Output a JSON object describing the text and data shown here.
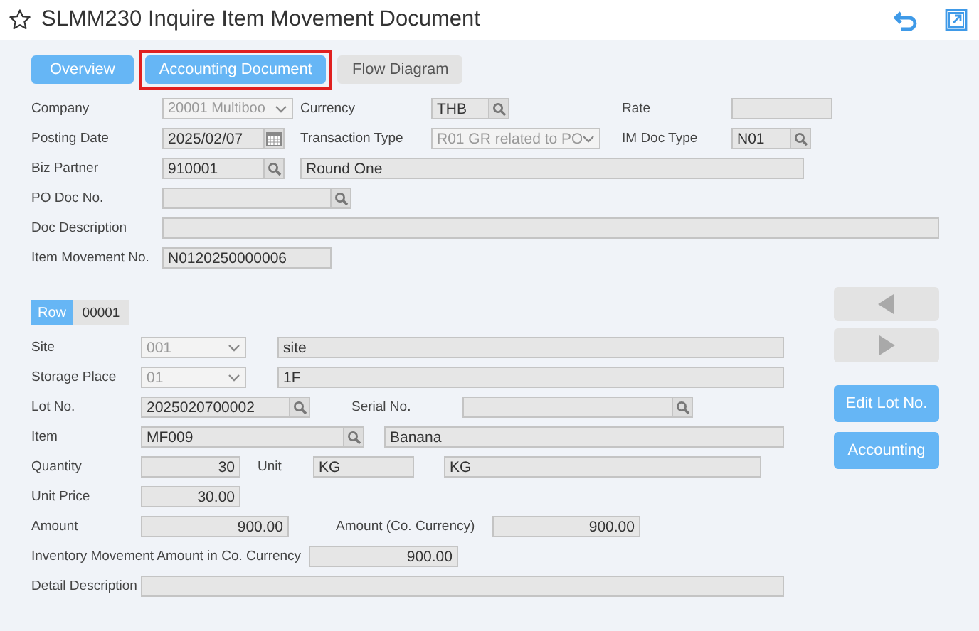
{
  "header": {
    "title": "SLMM230 Inquire Item Movement Document"
  },
  "tabs": [
    {
      "label": "Overview",
      "active": true,
      "highlighted": false
    },
    {
      "label": "Accounting Document",
      "active": true,
      "highlighted": true
    },
    {
      "label": "Flow Diagram",
      "active": false,
      "highlighted": false
    }
  ],
  "document": {
    "company": {
      "label": "Company",
      "kind": "select",
      "value": "20001 Multiboo",
      "disabled": true
    },
    "currency": {
      "label": "Currency",
      "kind": "lookup",
      "value": "THB"
    },
    "rate": {
      "label": "Rate",
      "kind": "text"
    },
    "posting_date": {
      "label": "Posting Date",
      "kind": "date",
      "value": "2025/02/07"
    },
    "transaction_type": {
      "label": "Transaction Type",
      "kind": "select",
      "value": "R01 GR related to PO",
      "disabled": true
    },
    "im_doc_type": {
      "label": "IM Doc Type",
      "kind": "lookup",
      "value": "N01"
    },
    "biz_partner": {
      "label": "Biz Partner",
      "kind": "lookup",
      "value": "910001"
    },
    "biz_partner_name": {
      "kind": "text",
      "value": "Round One"
    },
    "po_doc_no": {
      "label": "PO Doc No.",
      "kind": "lookup"
    },
    "doc_description": {
      "label": "Doc Description",
      "kind": "text"
    },
    "item_movement_no": {
      "label": "Item Movement No.",
      "kind": "text",
      "value": "N0120250000006"
    }
  },
  "row": {
    "label": "Row",
    "number": "00001"
  },
  "detail": {
    "site": {
      "label": "Site",
      "kind": "select",
      "value": "001",
      "disabled": true
    },
    "site_name": {
      "kind": "text",
      "value": "site"
    },
    "storage_place": {
      "label": "Storage Place",
      "kind": "select",
      "value": "01",
      "disabled": true
    },
    "storage_place_name": {
      "kind": "text",
      "value": "1F"
    },
    "lot_no": {
      "label": "Lot No.",
      "kind": "lookup",
      "value": "2025020700002"
    },
    "serial_no": {
      "label": "Serial No.",
      "kind": "lookup"
    },
    "item": {
      "label": "Item",
      "kind": "lookup",
      "value": "MF009"
    },
    "item_name": {
      "kind": "text",
      "value": "Banana"
    },
    "quantity": {
      "label": "Quantity",
      "kind": "number",
      "value": "30"
    },
    "unit": {
      "label": "Unit",
      "kind": "text",
      "value": "KG"
    },
    "unit_name": {
      "kind": "text",
      "value": "KG"
    },
    "unit_price": {
      "label": "Unit Price",
      "kind": "number",
      "value": "30.00"
    },
    "amount": {
      "label": "Amount",
      "kind": "number",
      "value": "900.00"
    },
    "amount_co": {
      "label": "Amount (Co. Currency)",
      "kind": "number",
      "value": "900.00"
    },
    "inventory_amount": {
      "label": "Inventory Movement Amount in Co. Currency",
      "kind": "number",
      "value": "900.00"
    },
    "detail_description": {
      "label": "Detail Description",
      "kind": "text"
    }
  },
  "side_buttons": [
    {
      "kind": "previous",
      "disabled": true
    },
    {
      "kind": "next",
      "disabled": true
    },
    {
      "kind": "label",
      "label": "Edit Lot No.",
      "disabled": false
    },
    {
      "kind": "label",
      "label": "Accounting",
      "disabled": false
    }
  ]
}
